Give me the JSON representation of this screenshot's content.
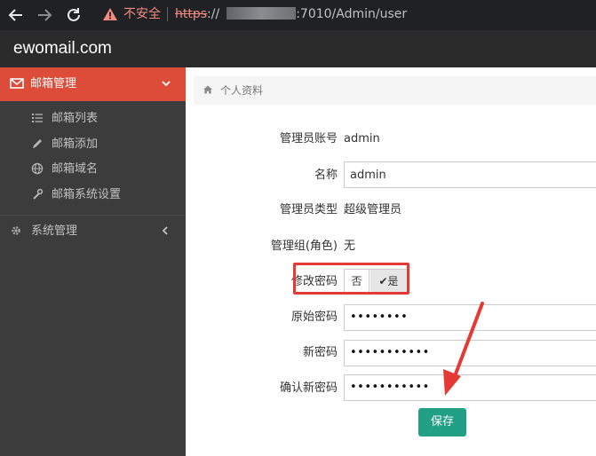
{
  "browser": {
    "back_icon": "arrow-left-icon",
    "forward_icon": "arrow-right-icon",
    "reload_icon": "reload-icon",
    "security_label": "不安全",
    "url_scheme": "https",
    "url_prefix": "://",
    "url_suffix": ":7010/Admin/user"
  },
  "app": {
    "brand": "ewomail.com"
  },
  "sidebar": {
    "active_menu": {
      "icon": "envelope-icon",
      "label": "邮箱管理",
      "chevron": "chevron-down-icon"
    },
    "sub_items": [
      {
        "icon": "list-icon",
        "label": "邮箱列表"
      },
      {
        "icon": "pencil-icon",
        "label": "邮箱添加"
      },
      {
        "icon": "globe-icon",
        "label": "邮箱域名"
      },
      {
        "icon": "wrench-icon",
        "label": "邮箱系统设置"
      }
    ],
    "system_menu": {
      "icon": "gear-icon",
      "label": "系统管理",
      "chevron": "chevron-left-icon"
    }
  },
  "main": {
    "breadcrumb": {
      "icon": "home-icon",
      "label": "个人资料"
    },
    "form": {
      "account_label": "管理员账号",
      "account_value": "admin",
      "name_label": "名称",
      "name_value": "admin",
      "type_label": "管理员类型",
      "type_value": "超级管理员",
      "group_label": "管理组(角色)",
      "group_value": "无",
      "change_password_label": "修改密码",
      "change_password_options": [
        "否",
        "是"
      ],
      "change_password_selected": "是",
      "old_password_label": "原始密码",
      "old_password_value": "••••••••",
      "new_password_label": "新密码",
      "new_password_value": "•••••••••••",
      "confirm_password_label": "确认新密码",
      "confirm_password_value": "•••••••••••",
      "save_label": "保存"
    }
  },
  "colors": {
    "accent_active_menu": "#dd4b39",
    "save_button": "#22a086",
    "annotation_red": "#e53935"
  }
}
